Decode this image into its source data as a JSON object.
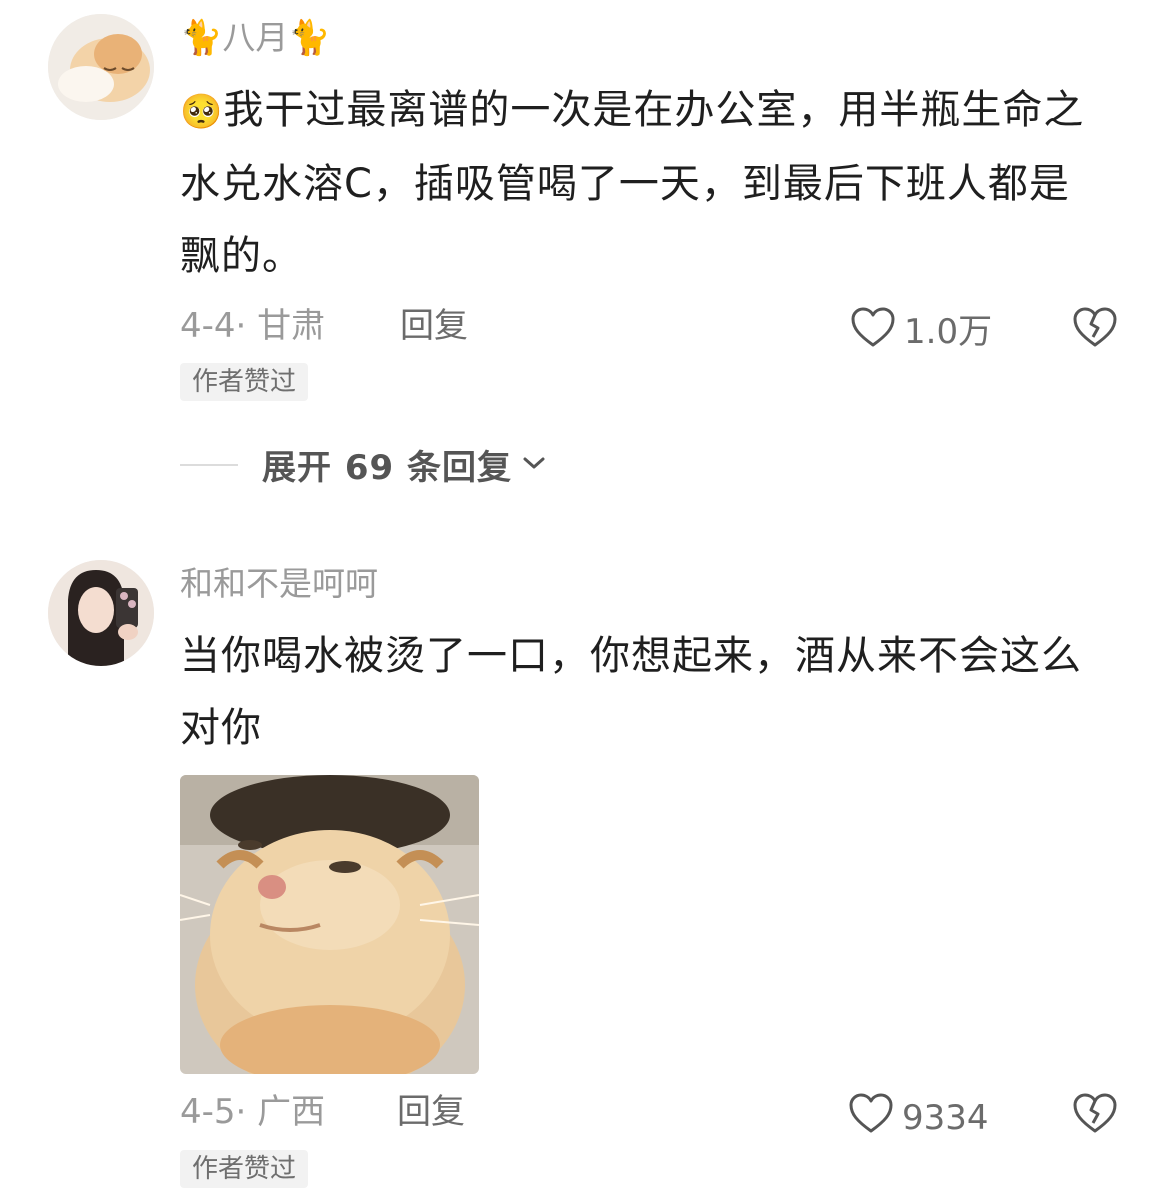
{
  "comments": [
    {
      "username": "八月",
      "username_emoji": "🐈",
      "lead_emoji": "🥺",
      "text": "我干过最离谱的一次是在办公室，用半瓶生命之水兑水溶C，插吸管喝了一天，到最后下班人都是飘的。",
      "date_location": "4-4· 甘肃",
      "reply_label": "回复",
      "likes": "1.0万",
      "badge": "作者赞过",
      "expand_label": "展开 69 条回复"
    },
    {
      "username": "和和不是呵呵",
      "text": "当你喝水被烫了一口，你想起来，酒从来不会这么对你",
      "date_location": "4-5· 广西",
      "reply_label": "回复",
      "likes": "9334",
      "badge": "作者赞过"
    }
  ]
}
